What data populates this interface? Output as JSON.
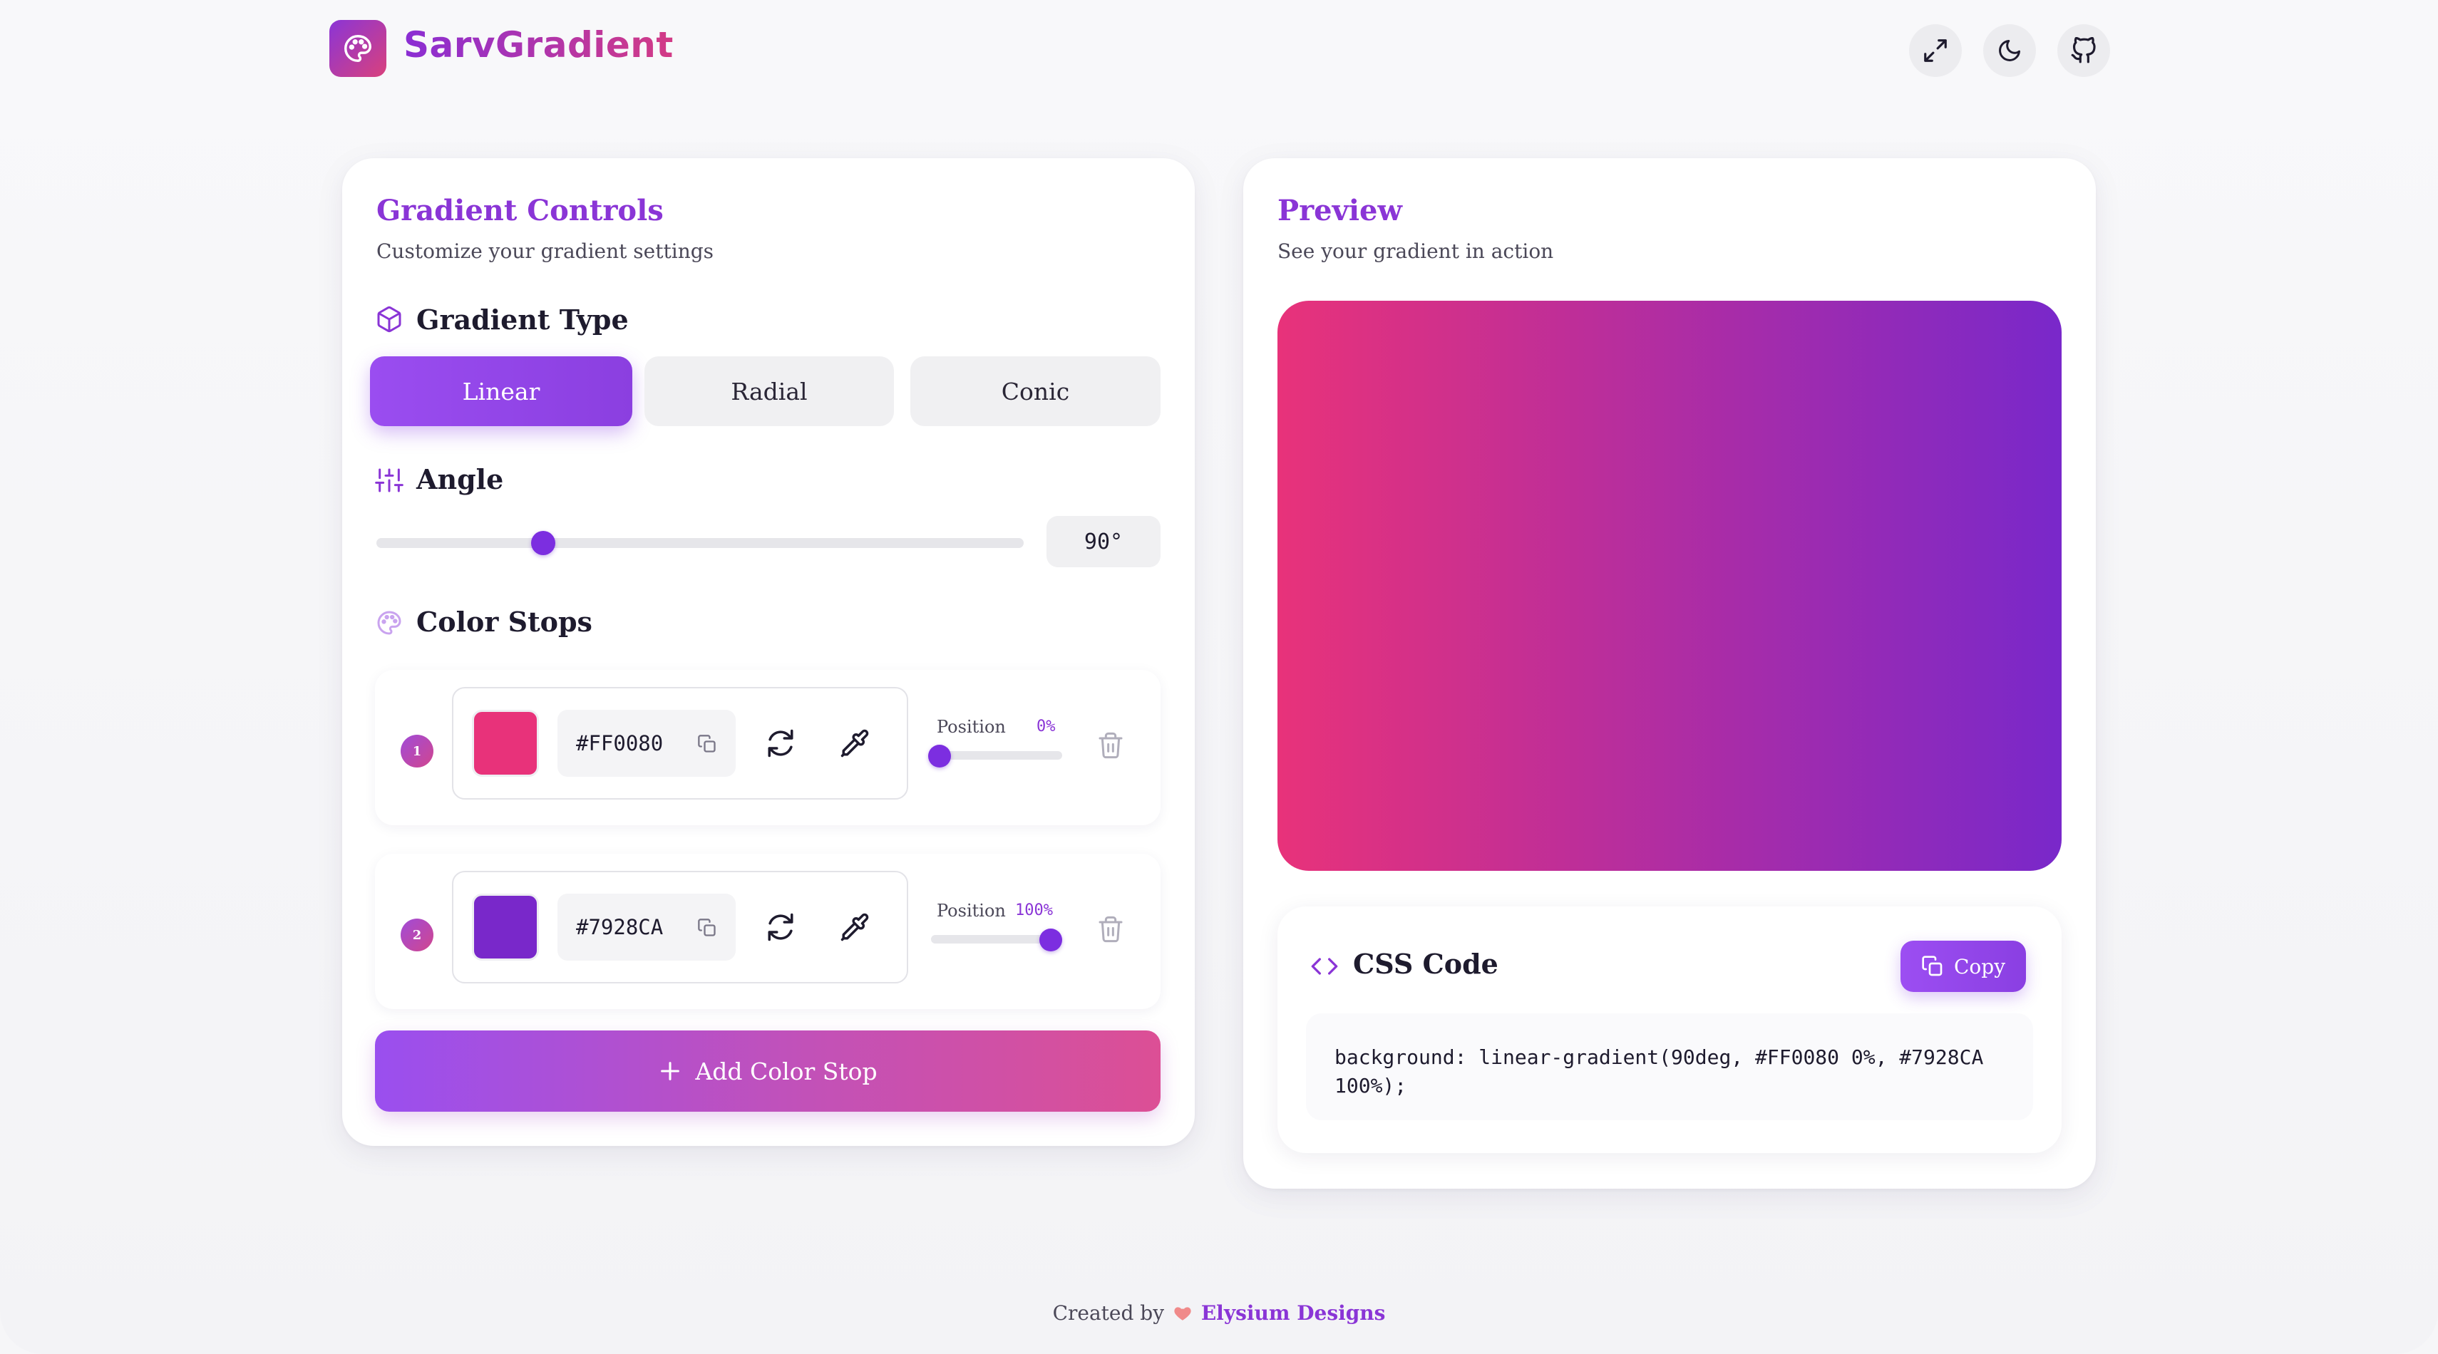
{
  "app": {
    "name": "SarvGradient"
  },
  "header": {
    "icons": [
      "palette-icon",
      "fullscreen-icon",
      "moon-icon",
      "github-icon"
    ]
  },
  "controls": {
    "title": "Gradient Controls",
    "subtitle": "Customize your gradient settings",
    "type_section": {
      "title": "Gradient Type",
      "options": [
        "Linear",
        "Radial",
        "Conic"
      ],
      "selected": "Linear"
    },
    "angle_section": {
      "title": "Angle",
      "value": 90,
      "value_label": "90°",
      "min": 0,
      "max": 360
    },
    "stops_section": {
      "title": "Color Stops",
      "position_label": "Position",
      "stops": [
        {
          "index": "1",
          "color": "#FF0080",
          "swatch": "#e8327a",
          "hex": "#FF0080",
          "position": 0,
          "position_label": "0%"
        },
        {
          "index": "2",
          "color": "#7928CA",
          "swatch": "#7928ca",
          "hex": "#7928CA",
          "position": 100,
          "position_label": "100%"
        }
      ]
    },
    "add_button": "Add Color Stop"
  },
  "preview": {
    "title": "Preview",
    "subtitle": "See your gradient in action",
    "gradient": {
      "start": "#e8327a",
      "end": "#7928ca",
      "angle": 90
    }
  },
  "css_code": {
    "title": "CSS Code",
    "copy_label": "Copy",
    "code": "background: linear-gradient(90deg, #FF0080 0%, #7928CA 100%);"
  },
  "footer": {
    "prefix": "Created by",
    "brand": "Elysium Designs"
  },
  "colors": {
    "accent": "#8a35d6",
    "accent_strong": "#7c2ee0",
    "pink": "#dc4f95"
  }
}
